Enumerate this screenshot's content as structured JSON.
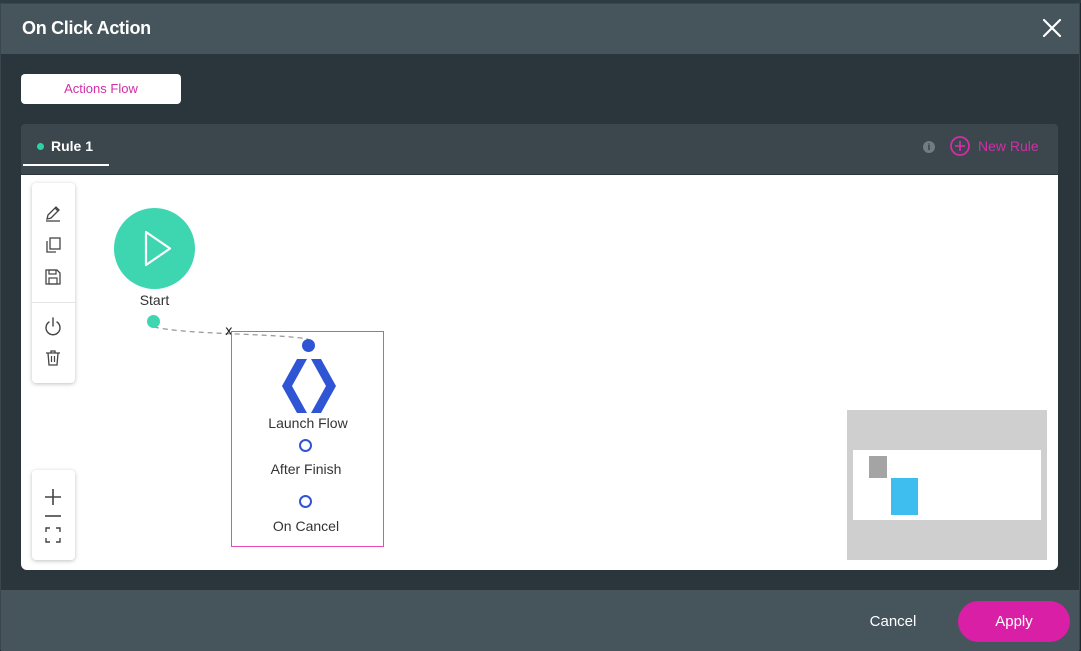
{
  "window": {
    "title": "On Click Action"
  },
  "tabs": {
    "actions_flow": "Actions Flow"
  },
  "rules": {
    "active_tab": "Rule 1",
    "info_glyph": "i",
    "new_rule_label": "New Rule"
  },
  "toolbar": {
    "icons": [
      "edit-icon",
      "copy-icon",
      "save-icon",
      "power-icon",
      "trash-icon"
    ]
  },
  "zoom": {
    "icons": [
      "plus-icon",
      "minus-icon",
      "fit-screen-icon"
    ]
  },
  "nodes": {
    "start": {
      "label": "Start"
    },
    "launch_flow": {
      "label": "Launch Flow",
      "outputs": [
        "After Finish",
        "On Cancel"
      ]
    }
  },
  "connector": {
    "delete_glyph": "x"
  },
  "footer": {
    "cancel_label": "Cancel",
    "apply_label": "Apply"
  },
  "colors": {
    "accent": "#d81fa6",
    "start_node": "#3dd6b0",
    "flow_blue": "#2f55d4",
    "selection": "#e94bb4"
  }
}
